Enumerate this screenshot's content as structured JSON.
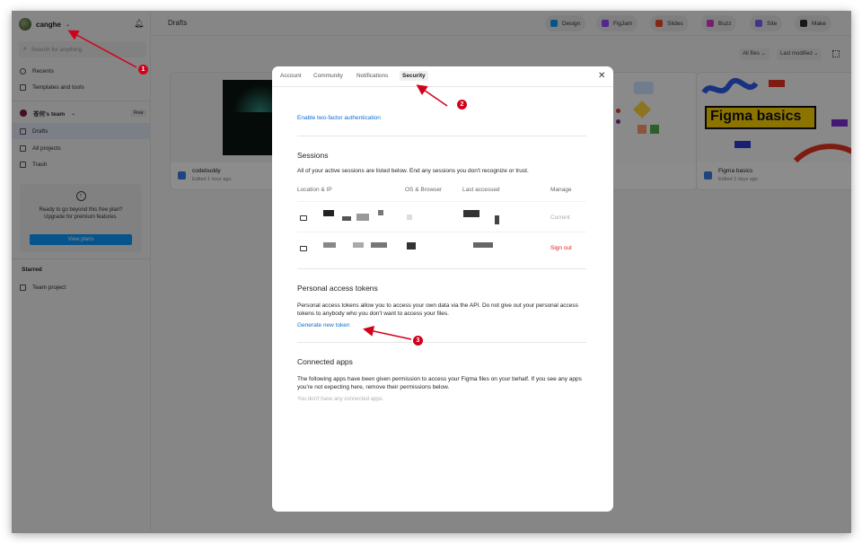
{
  "sidebar": {
    "username": "canghe",
    "search_placeholder": "Search for anything",
    "nav": [
      {
        "label": "Recents",
        "icon": "clock-icon"
      },
      {
        "label": "Templates and tools",
        "icon": "grid-icon"
      }
    ],
    "team": {
      "name": "苍何's team",
      "badge": "Free"
    },
    "team_nav": [
      {
        "label": "Drafts",
        "icon": "file-icon"
      },
      {
        "label": "All projects",
        "icon": "grid-icon"
      },
      {
        "label": "Trash",
        "icon": "trash-icon"
      }
    ],
    "upgrade": {
      "line1": "Ready to go beyond this free plan?",
      "line2": "Upgrade for premium features.",
      "button": "View plans"
    },
    "starred_title": "Starred",
    "starred_items": [
      {
        "label": "Team project"
      }
    ]
  },
  "header": {
    "title": "Drafts",
    "products": [
      {
        "label": "Design",
        "color": "#0d99ff"
      },
      {
        "label": "FigJam",
        "color": "#9747ff"
      },
      {
        "label": "Slides",
        "color": "#f24822"
      },
      {
        "label": "Buzz",
        "color": "#d83ad0"
      },
      {
        "label": "Site",
        "color": "#7b61ff"
      },
      {
        "label": "Make",
        "color": "#2c2c2c"
      }
    ],
    "filters": {
      "files": "All files",
      "sort": "Last modified"
    }
  },
  "files": [
    {
      "name": "codebuddy",
      "edited": "Edited 1 hour ago"
    },
    {
      "name": "Figma basics",
      "edited": "Edited 2 days ago",
      "thumb_text": "Figma basics"
    }
  ],
  "modal": {
    "tabs": [
      "Account",
      "Community",
      "Notifications",
      "Security"
    ],
    "active_tab": "Security",
    "two_factor_link": "Enable two-factor authentication",
    "sessions": {
      "title": "Sessions",
      "description": "All of your active sessions are listed below. End any sessions you don't recognize or trust.",
      "columns": [
        "Location & IP",
        "OS & Browser",
        "Last accessed",
        "Manage"
      ],
      "rows": [
        {
          "manage": "Current"
        },
        {
          "manage": "Sign out"
        }
      ]
    },
    "tokens": {
      "title": "Personal access tokens",
      "description": "Personal access tokens allow you to access your own data via the API. Do not give out your personal access tokens to anybody who you don't want to access your files.",
      "link": "Generate new token"
    },
    "apps": {
      "title": "Connected apps",
      "description": "The following apps have been given permission to access your Figma files on your behalf. If you see any apps you're not expecting here, remove their permissions below.",
      "empty": "You don't have any connected apps."
    }
  },
  "annotations": [
    "1",
    "2",
    "3"
  ]
}
